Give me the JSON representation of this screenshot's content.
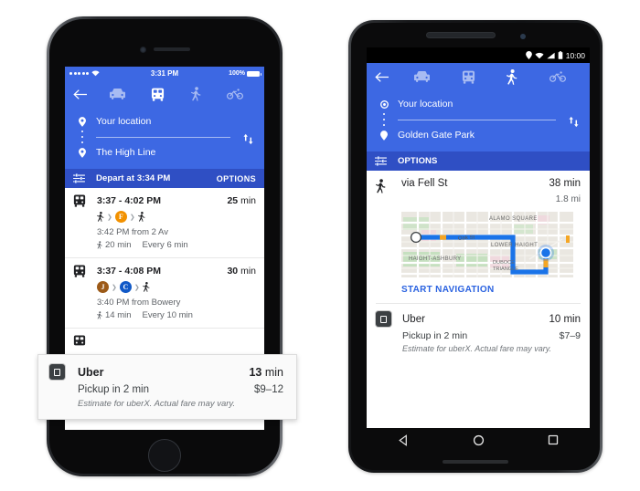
{
  "iphone": {
    "status": {
      "carrier_dots": 5,
      "wifi_icon": "wifi-icon",
      "time": "3:31 PM",
      "battery_percent": "100%"
    },
    "header": {
      "back_icon": "back-arrow-icon",
      "modes": [
        {
          "name": "driving",
          "icon": "car-icon",
          "active": false
        },
        {
          "name": "transit",
          "icon": "transit-train-icon",
          "active": true
        },
        {
          "name": "walking",
          "icon": "walking-person-icon",
          "active": false
        },
        {
          "name": "cycling",
          "icon": "bicycle-icon",
          "active": false
        }
      ],
      "origin": "Your location",
      "destination": "The High Line",
      "swap_icon": "swap-vertical-icon"
    },
    "options_bar": {
      "filter_icon": "tune-sliders-icon",
      "depart_label": "Depart at 3:34 PM",
      "options_label": "OPTIONS"
    },
    "results": [
      {
        "mode_icon": "transit-train-icon",
        "times": "3:37 - 4:02 PM",
        "duration_value": "25",
        "duration_unit": "min",
        "legs": [
          {
            "type": "walk",
            "label": "",
            "color": ""
          },
          {
            "type": "line",
            "label": "F",
            "color": "#f29100"
          },
          {
            "type": "walk",
            "label": "",
            "color": ""
          }
        ],
        "departure": "3:42 PM from 2 Av",
        "walk_time": "20 min",
        "frequency": "Every 6 min"
      },
      {
        "mode_icon": "transit-train-icon",
        "times": "3:37 - 4:08 PM",
        "duration_value": "30",
        "duration_unit": "min",
        "legs": [
          {
            "type": "line",
            "label": "J",
            "color": "#9c5a18"
          },
          {
            "type": "line",
            "label": "C",
            "color": "#1159c7"
          },
          {
            "type": "walk",
            "label": "",
            "color": ""
          }
        ],
        "departure": "3:40 PM from Bowery",
        "walk_time": "14 min",
        "frequency": "Every 10 min"
      }
    ],
    "uber_card": {
      "icon": "uber-app-icon",
      "provider": "Uber",
      "eta_value": "13",
      "eta_unit": "min",
      "pickup": "Pickup in 2 min",
      "price": "$9–12",
      "disclaimer": "Estimate for uberX. Actual fare may vary."
    }
  },
  "android": {
    "status": {
      "icons": [
        "location-pin-icon",
        "wifi-icon",
        "signal-bars-icon",
        "battery-icon"
      ],
      "time": "10:00"
    },
    "header": {
      "back_icon": "back-arrow-icon",
      "modes": [
        {
          "name": "driving",
          "icon": "car-icon",
          "active": false
        },
        {
          "name": "transit",
          "icon": "transit-train-icon",
          "active": false
        },
        {
          "name": "walking",
          "icon": "walking-person-icon",
          "active": true
        },
        {
          "name": "cycling",
          "icon": "bicycle-icon",
          "active": false
        }
      ],
      "origin": "Your location",
      "destination": "Golden Gate Park",
      "swap_icon": "swap-vertical-icon"
    },
    "options_bar": {
      "filter_icon": "tune-sliders-icon",
      "options_label": "OPTIONS"
    },
    "route": {
      "mode_icon": "walking-person-icon",
      "via": "via Fell St",
      "duration": "38 min",
      "distance": "1.8 mi",
      "start_navigation_label": "START NAVIGATION",
      "map_labels": [
        "ALAMO SQUARE",
        "LOWER HAIGHT",
        "HAIGHT-ASHBURY",
        "Oak St",
        "DUBOCE TRIANGLE"
      ],
      "map_route_color": "#1a73e8"
    },
    "uber_card": {
      "icon": "uber-app-icon",
      "provider": "Uber",
      "eta_value": "10 min",
      "pickup": "Pickup in 2 min",
      "price": "$7–9",
      "disclaimer": "Estimate for uberX. Actual fare may vary."
    },
    "navbar": {
      "back_icon": "nav-back-triangle-icon",
      "home_icon": "nav-home-circle-icon",
      "recents_icon": "nav-recents-square-icon"
    }
  },
  "theme": {
    "google_blue": "#3d68e3",
    "options_blue": "#2f4fc4",
    "link_blue": "#2a62e0",
    "text_primary": "#202124",
    "text_secondary": "#5f6368"
  }
}
